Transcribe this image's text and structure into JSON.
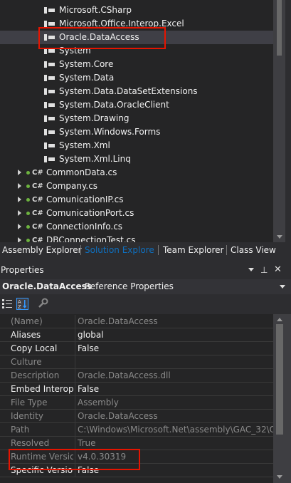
{
  "tree": {
    "references": [
      {
        "label": "Microsoft.CSharp",
        "selected": false
      },
      {
        "label": "Microsoft.Office.Interop.Excel",
        "selected": false
      },
      {
        "label": "Oracle.DataAccess",
        "selected": true
      },
      {
        "label": "System",
        "selected": false
      },
      {
        "label": "System.Core",
        "selected": false
      },
      {
        "label": "System.Data",
        "selected": false
      },
      {
        "label": "System.Data.DataSetExtensions",
        "selected": false
      },
      {
        "label": "System.Data.OracleClient",
        "selected": false
      },
      {
        "label": "System.Drawing",
        "selected": false
      },
      {
        "label": "System.Windows.Forms",
        "selected": false
      },
      {
        "label": "System.Xml",
        "selected": false
      },
      {
        "label": "System.Xml.Linq",
        "selected": false
      }
    ],
    "files": [
      {
        "label": "CommonData.cs",
        "icon": "C#"
      },
      {
        "label": "Company.cs",
        "icon": "C#"
      },
      {
        "label": "ComunicationIP.cs",
        "icon": "C#"
      },
      {
        "label": "ComunicationPort.cs",
        "icon": "C#"
      },
      {
        "label": "ConnectionInfo.cs",
        "icon": "C#"
      },
      {
        "label": "DBConnectionTest.cs",
        "icon": "C#"
      }
    ]
  },
  "tabs": [
    {
      "label": "Assembly Explorer",
      "active": false
    },
    {
      "label": "Solution Explore",
      "active": true
    },
    {
      "label": "Team Explorer",
      "active": false
    },
    {
      "label": "Class View",
      "active": false
    }
  ],
  "properties": {
    "title": "Properties",
    "pin_glyph": "▾ ⊣ ✕",
    "object_name": "Oracle.DataAccess",
    "object_type": "Reference Properties",
    "rows": [
      {
        "name": "(Name)",
        "value": "Oracle.DataAccess",
        "editable": false
      },
      {
        "name": "Aliases",
        "value": "global",
        "editable": true
      },
      {
        "name": "Copy Local",
        "value": "False",
        "editable": true
      },
      {
        "name": "Culture",
        "value": "",
        "editable": false
      },
      {
        "name": "Description",
        "value": "Oracle.DataAccess.dll",
        "editable": false
      },
      {
        "name": "Embed Interop",
        "value": "False",
        "editable": true
      },
      {
        "name": "File Type",
        "value": "Assembly",
        "editable": false
      },
      {
        "name": "Identity",
        "value": "Oracle.DataAccess",
        "editable": false
      },
      {
        "name": "Path",
        "value": "C:\\Windows\\Microsoft.Net\\assembly\\GAC_32\\O",
        "editable": false
      },
      {
        "name": "Resolved",
        "value": "True",
        "editable": false
      },
      {
        "name": "Runtime Versio",
        "value": "v4.0.30319",
        "editable": false
      },
      {
        "name": "Specific Versior",
        "value": "False",
        "editable": true
      }
    ]
  },
  "colors": {
    "accent": "#0e70c0",
    "highlight": "#e51400"
  }
}
